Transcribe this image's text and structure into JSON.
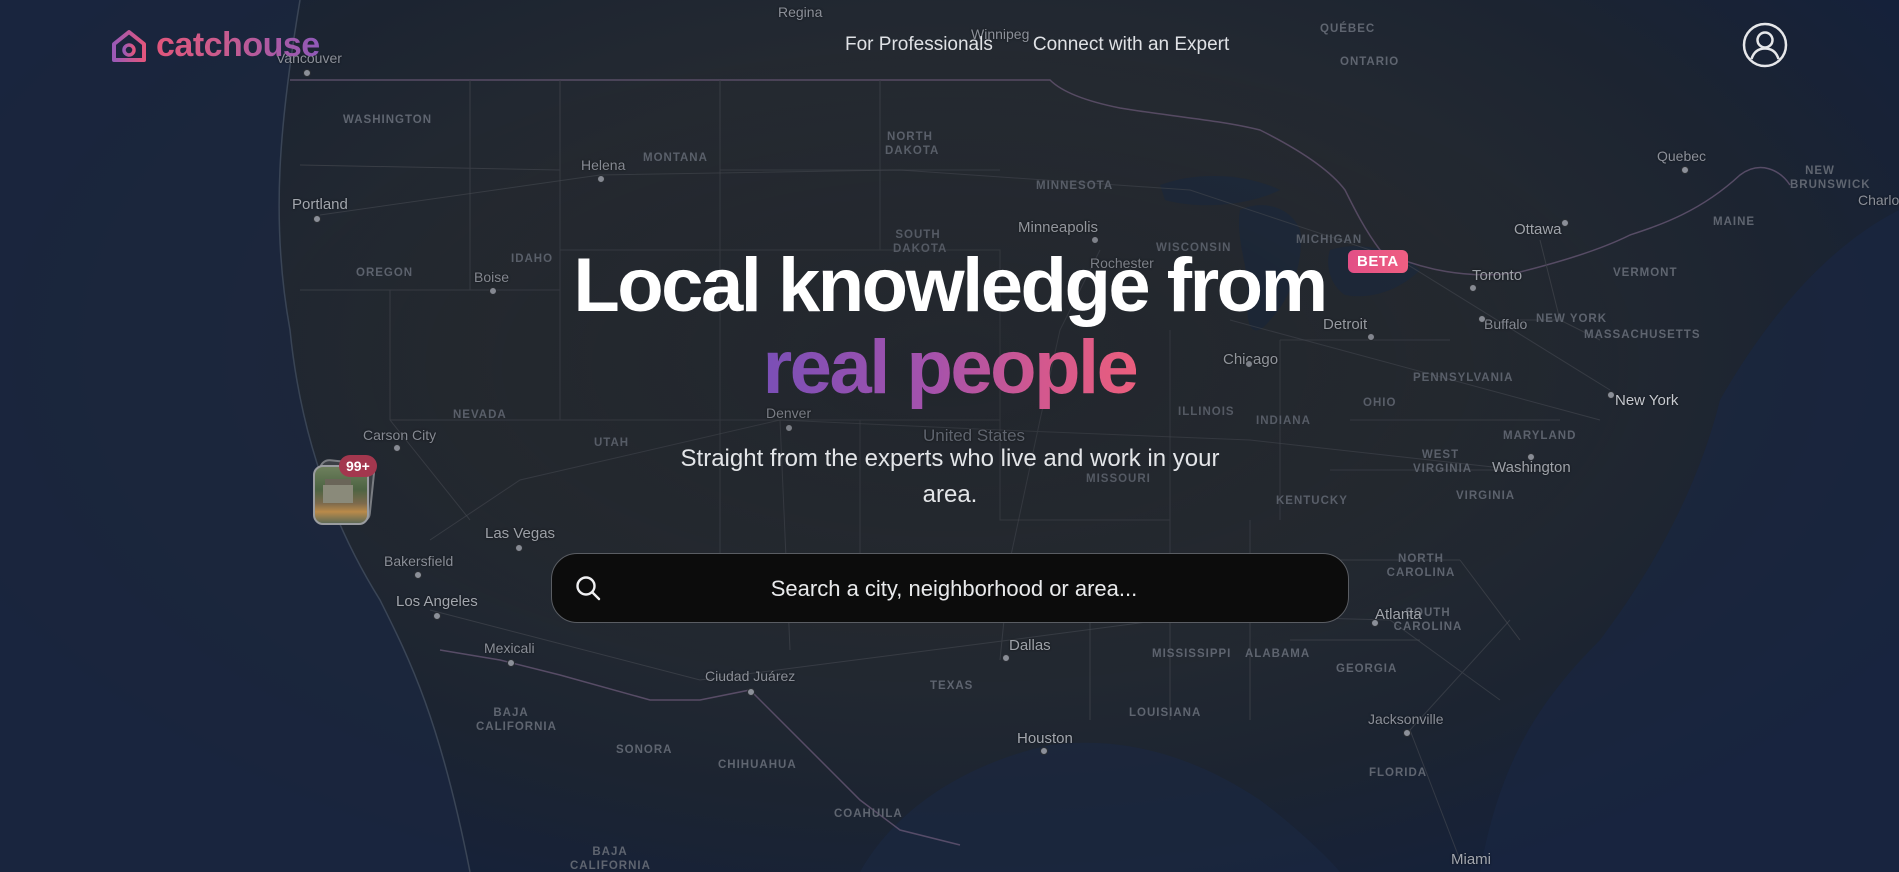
{
  "app": {
    "logo_text": "catchouse",
    "brand_colors": [
      "#e0567c",
      "#8f59b8"
    ]
  },
  "nav": {
    "items": [
      {
        "label": "For Professionals"
      },
      {
        "label": "Connect with an Expert"
      }
    ]
  },
  "hero": {
    "title_line1": "Local knowledge from",
    "title_line2": "real people",
    "beta_badge": "BETA",
    "subtitle": "Straight from the experts who live and work in your area."
  },
  "search": {
    "placeholder": "Search a city, neighborhood or area...",
    "value": ""
  },
  "map_marker": {
    "count_label": "99+"
  },
  "map": {
    "places": [
      "Regina",
      "Winnipeg",
      "Vancouver",
      "Helena",
      "Portland",
      "Boise",
      "Minneapolis",
      "Rochester",
      "Ottawa",
      "Quebec",
      "Toronto",
      "Buffalo",
      "Detroit",
      "Chicago",
      "New York",
      "Washington",
      "Denver",
      "Carson City",
      "Las Vegas",
      "Bakersfield",
      "Los Angeles",
      "Mexicali",
      "Ciudad Juárez",
      "Dallas",
      "Houston",
      "Atlanta",
      "Jacksonville",
      "Miami",
      "Charlo"
    ],
    "country": "United States",
    "regions": [
      "QUÉBEC",
      "ONTARIO",
      "WASHINGTON",
      "MONTANA",
      "NORTH DAKOTA",
      "MINNESOTA",
      "SOUTH DAKOTA",
      "IDAHO",
      "OREGON",
      "WISCONSIN",
      "MICHIGAN",
      "NEW BRUNSWICK",
      "MAINE",
      "VERMONT",
      "NEW YORK",
      "MASSACHUSETTS",
      "PENNSYLVANIA",
      "OHIO",
      "ILLINOIS",
      "INDIANA",
      "NEVADA",
      "UTAH",
      "MISSOURI",
      "MARYLAND",
      "WEST VIRGINIA",
      "VIRGINIA",
      "KENTUCKY",
      "NORTH CAROLINA",
      "SOUTH CAROLINA",
      "MISSISSIPPI",
      "ALABAMA",
      "GEORGIA",
      "TEXAS",
      "LOUISIANA",
      "FLORIDA",
      "BAJA CALIFORNIA",
      "SONORA",
      "CHIHUAHUA",
      "COAHUILA",
      "BAJA CALIFORNIA SUR"
    ]
  }
}
